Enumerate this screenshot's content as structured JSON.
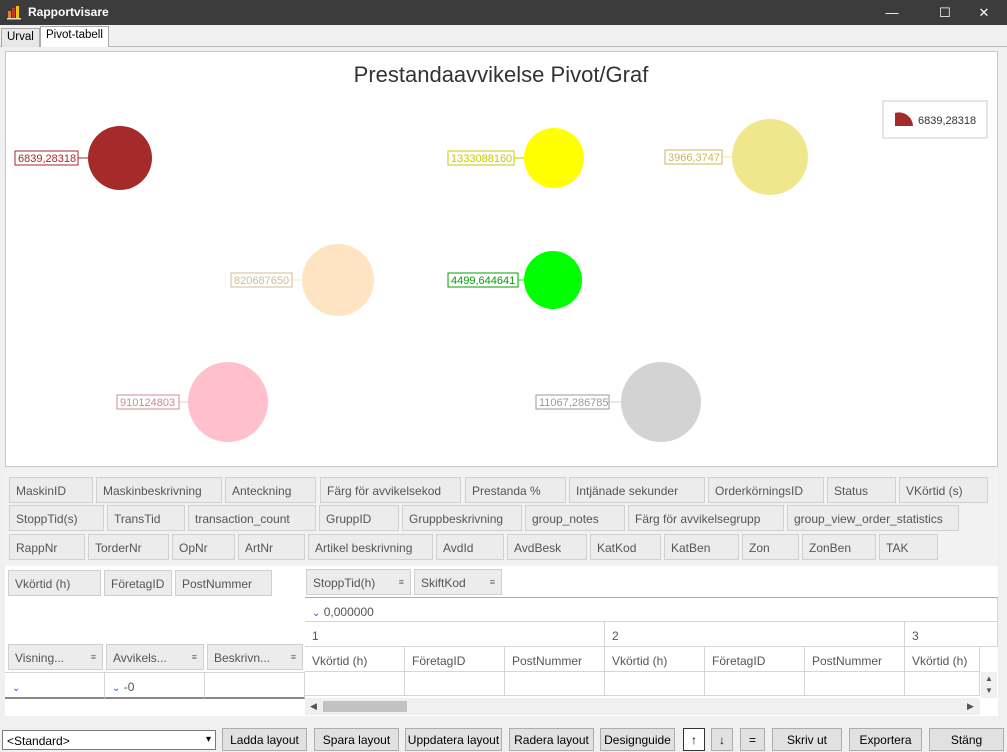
{
  "window": {
    "title": "Rapportvisare",
    "minimize": "—",
    "maximize": "☐",
    "close": "✕"
  },
  "tabs": [
    "Urval",
    "Pivot-tabell"
  ],
  "chart_data": {
    "type": "scatter",
    "title": "Prestandaavvikelse Pivot/Graf",
    "points": [
      {
        "label": "6839,28318",
        "color": "#a52a2a"
      },
      {
        "label": "1333088160",
        "color": "#ffff00"
      },
      {
        "label": "3966,3747",
        "color": "#f0e68c"
      },
      {
        "label": "820687650",
        "color": "#ffe4c4"
      },
      {
        "label": "4499,644641",
        "color": "#00ff00"
      },
      {
        "label": "910124803",
        "color": "#ffc0cb"
      },
      {
        "label": "11067,286785",
        "color": "#d3d3d3"
      }
    ],
    "legend": {
      "position": "top-right",
      "entries": [
        {
          "name": "6839,28318",
          "color": "#a52a2a"
        }
      ]
    }
  },
  "fields": {
    "row1": [
      "MaskinID",
      "Maskinbeskrivning",
      "Anteckning",
      "Färg för avvikelsekod",
      "Prestanda %",
      "Intjänade sekunder",
      "OrderkörningsID",
      "Status",
      "VKörtid (s)"
    ],
    "row2": [
      "StoppTid(s)",
      "TransTid",
      "transaction_count",
      "GruppID",
      "Gruppbeskrivning",
      "group_notes",
      "Färg för avvikelsegrupp",
      "group_view_order_statistics"
    ],
    "row3": [
      "RappNr",
      "TorderNr",
      "OpNr",
      "ArtNr",
      "Artikel beskrivning",
      "AvdId",
      "AvdBesk",
      "KatKod",
      "KatBen",
      "Zon",
      "ZonBen",
      "TAK"
    ]
  },
  "pivot": {
    "filter_fields": [
      "Vkörtid (h)",
      "FöretagID",
      "PostNummer"
    ],
    "column_fields": [
      "StoppTid(h)",
      "SkiftKod"
    ],
    "row_fields": [
      "Visning...",
      "Avvikels...",
      "Beskrivn..."
    ],
    "row_value": "-0",
    "column_value": "0,000000",
    "column_groups": [
      "1",
      "2",
      "3"
    ],
    "data_headers": [
      "Vkörtid (h)",
      "FöretagID",
      "PostNummer",
      "Vkörtid (h)",
      "FöretagID",
      "PostNummer",
      "Vkörtid (h)"
    ]
  },
  "bottom": {
    "layout_select": "<Standard>",
    "buttons": [
      "Ladda layout",
      "Spara layout",
      "Uppdatera layout",
      "Radera layout",
      "Designguide",
      "↑",
      "↓",
      "=",
      "Skriv ut",
      "Exportera",
      "Stäng"
    ]
  }
}
